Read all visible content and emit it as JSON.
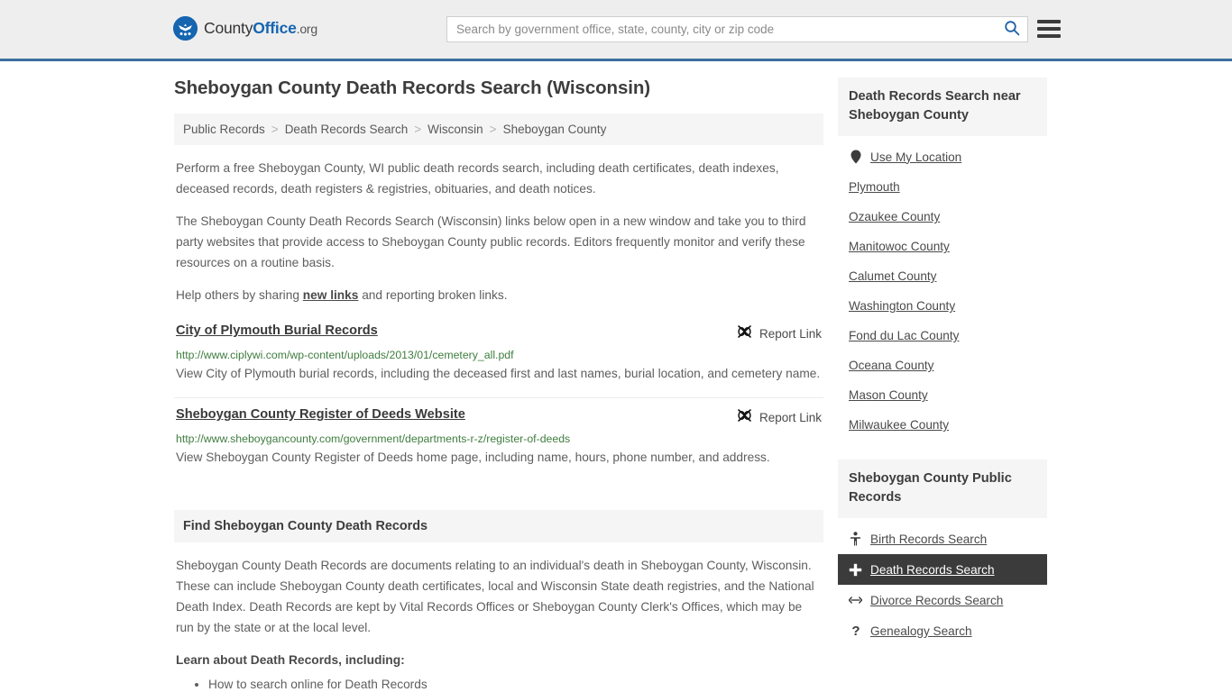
{
  "header": {
    "logo": {
      "part1": "County",
      "part2": "Office",
      "part3": ".org",
      "icon": "eagle-seal-icon"
    },
    "search": {
      "placeholder": "Search by government office, state, county, city or zip code",
      "value": "",
      "icon": "search-icon"
    },
    "menu": {
      "icon": "hamburger-menu-icon",
      "label": "Menu"
    },
    "accent_color": "#3b6f9e",
    "background_color": "#eeeeee"
  },
  "page": {
    "title": "Sheboygan County Death Records Search (Wisconsin)",
    "breadcrumb": [
      "Public Records",
      "Death Records Search",
      "Wisconsin",
      "Sheboygan County"
    ],
    "breadcrumb_separator": ">",
    "intro_paragraphs": [
      "Perform a free Sheboygan County, WI public death records search, including death certificates, death indexes, deceased records, death registers & registries, obituaries, and death notices.",
      "The Sheboygan County Death Records Search (Wisconsin) links below open in a new window and take you to third party websites that provide access to Sheboygan County public records. Editors frequently monitor and verify these resources on a routine basis."
    ],
    "help_line": {
      "before": "Help others by sharing ",
      "link": "new links",
      "after": " and reporting broken links."
    }
  },
  "links": {
    "report_label": "Report Link",
    "report_icon": "broken-link-icon",
    "items": [
      {
        "title": "City of Plymouth Burial Records",
        "url": "http://www.ciplywi.com/wp-content/uploads/2013/01/cemetery_all.pdf",
        "description": "View City of Plymouth burial records, including the deceased first and last names, burial location, and cemetery name."
      },
      {
        "title": "Sheboygan County Register of Deeds Website",
        "url": "http://www.sheboygancounty.com/government/departments-r-z/register-of-deeds",
        "description": "View Sheboygan County Register of Deeds home page, including name, hours, phone number, and address."
      }
    ],
    "url_color": "#3f7d3f"
  },
  "find_section": {
    "heading": "Find Sheboygan County Death Records",
    "paragraph": "Sheboygan County Death Records are documents relating to an individual's death in Sheboygan County, Wisconsin. These can include Sheboygan County death certificates, local and Wisconsin State death registries, and the National Death Index. Death Records are kept by Vital Records Offices or Sheboygan County Clerk's Offices, which may be run by the state or at the local level.",
    "learn_lead": "Learn about Death Records, including:",
    "bullets": [
      "How to search online for Death Records"
    ]
  },
  "sidebar": {
    "nearby": {
      "heading": "Death Records Search near Sheboygan County",
      "items": [
        {
          "label": "Use My Location",
          "icon": "map-pin-icon"
        },
        {
          "label": "Plymouth",
          "icon": ""
        },
        {
          "label": "Ozaukee County",
          "icon": ""
        },
        {
          "label": "Manitowoc County",
          "icon": ""
        },
        {
          "label": "Calumet County",
          "icon": ""
        },
        {
          "label": "Washington County",
          "icon": ""
        },
        {
          "label": "Fond du Lac County",
          "icon": ""
        },
        {
          "label": "Oceana County",
          "icon": ""
        },
        {
          "label": "Mason County",
          "icon": ""
        },
        {
          "label": "Milwaukee County",
          "icon": ""
        }
      ]
    },
    "public_records": {
      "heading": "Sheboygan County Public Records",
      "items": [
        {
          "label": "Birth Records Search",
          "icon": "baby-icon",
          "active": false
        },
        {
          "label": "Death Records Search",
          "icon": "cross-icon",
          "active": true
        },
        {
          "label": "Divorce Records Search",
          "icon": "split-arrows-icon",
          "active": false
        },
        {
          "label": "Genealogy Search",
          "icon": "question-mark-icon",
          "active": false
        }
      ],
      "active_background": "#3b3b3b"
    }
  }
}
